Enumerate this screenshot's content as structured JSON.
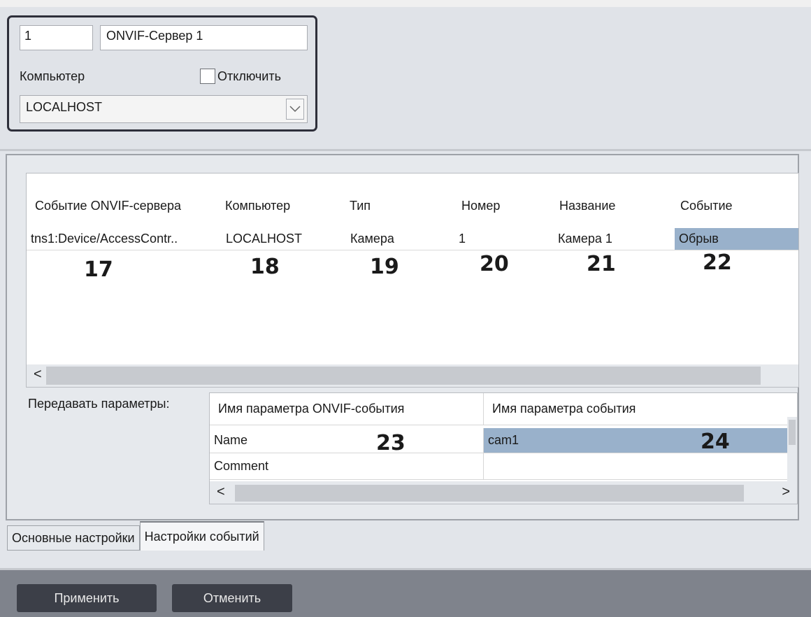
{
  "object": {
    "id_value": "1",
    "name_value": "ONVIF-Сервер 1",
    "computer_label": "Компьютер",
    "disable_label": "Отключить",
    "computer_value": "LOCALHOST"
  },
  "events_grid": {
    "columns": [
      "Событие ONVIF-сервера",
      "Компьютер",
      "Тип",
      "Номер",
      "Название",
      "Событие"
    ],
    "row": [
      "tns1:Device/AccessContr..",
      "LOCALHOST",
      "Камера",
      "1",
      "Камера 1",
      "Обрыв"
    ],
    "callouts": [
      "17",
      "18",
      "19",
      "20",
      "21",
      "22"
    ],
    "scroll_left": "<",
    "scroll_right": ":"
  },
  "params": {
    "label": "Передавать параметры:",
    "columns": [
      "Имя параметра ONVIF-события",
      "Имя параметра события"
    ],
    "rows": [
      [
        "Name",
        "cam1"
      ],
      [
        "Comment",
        ""
      ]
    ],
    "callouts": [
      "23",
      "24"
    ],
    "scroll_left": "<",
    "scroll_right": ">"
  },
  "tabs": [
    "Основные настройки",
    "Настройки событий"
  ],
  "buttons": {
    "apply": "Применить",
    "cancel": "Отменить"
  },
  "colors": {
    "selection": "#99b1cb",
    "footer": "#7f838c",
    "button": "#3c3f48"
  }
}
